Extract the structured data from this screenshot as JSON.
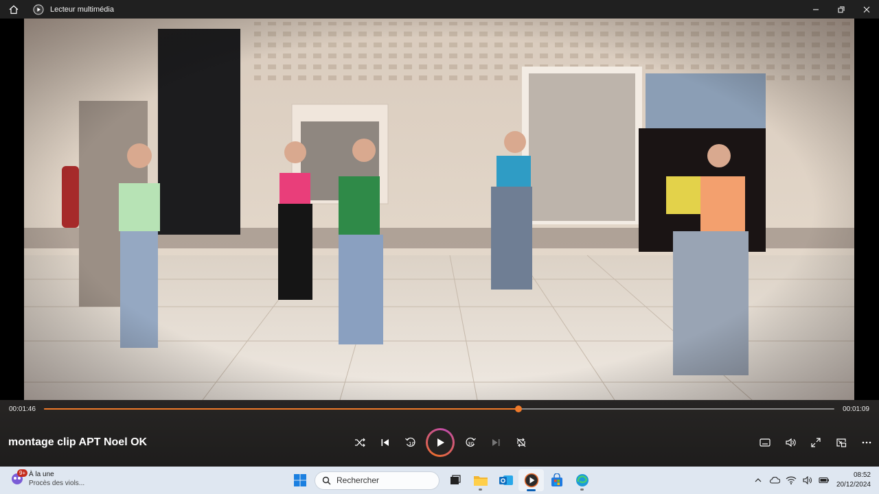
{
  "window": {
    "title": "Lecteur multimédia"
  },
  "media": {
    "title": "montage  clip APT Noel OK",
    "elapsed": "00:01:46",
    "remaining": "00:01:09",
    "progress_fraction": 0.6
  },
  "controls": {
    "left": [
      "shuffle-icon",
      "previous-icon",
      "rewind-10-icon",
      "play-icon",
      "forward-30-icon",
      "next-icon",
      "repeat-off-icon"
    ],
    "rewind_label": "10",
    "forward_label": "30",
    "right": [
      "captions-icon",
      "volume-icon",
      "fullscreen-icon",
      "mini-player-icon",
      "more-icon"
    ]
  },
  "taskbar": {
    "news_badge": "9+",
    "news_title": "À la une",
    "news_subtitle": "Procès des viols...",
    "search_placeholder": "Rechercher",
    "time": "08:52",
    "date": "20/12/2024"
  },
  "colors": {
    "accent": "#f07a2a",
    "play_ring_a": "#e96c2f",
    "play_ring_b": "#c04ca8",
    "taskbar": "#dfe7f1",
    "titlebar": "#202020"
  }
}
